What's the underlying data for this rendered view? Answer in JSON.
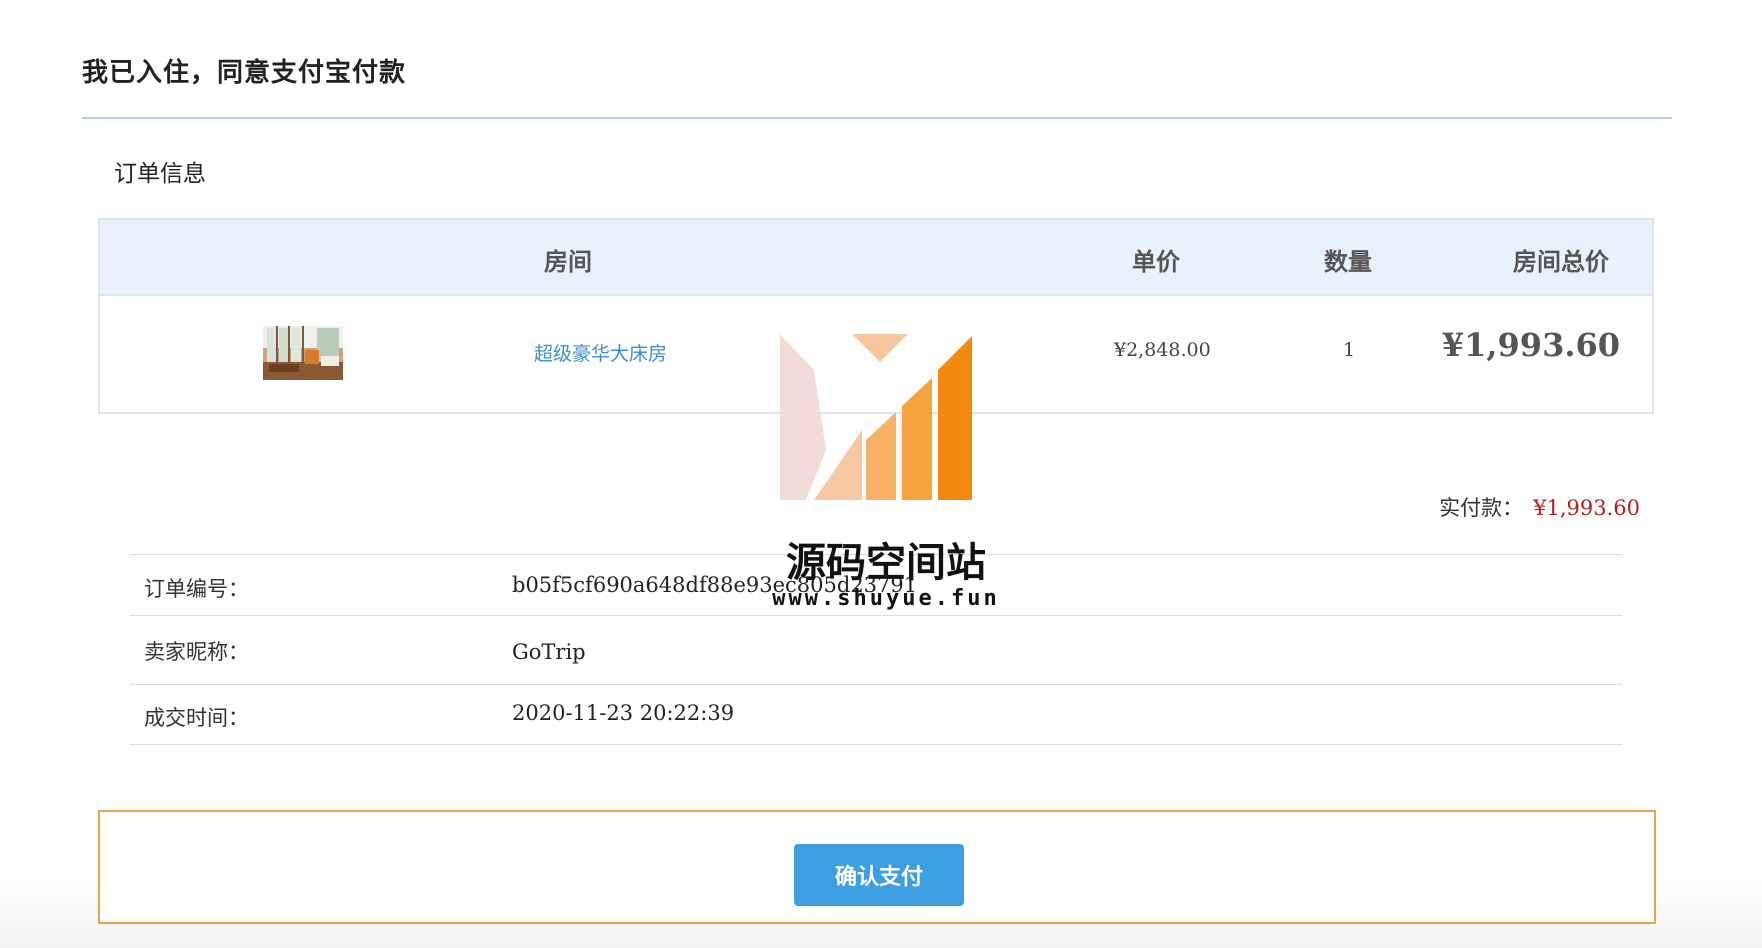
{
  "page": {
    "title": "我已入住，同意支付宝付款"
  },
  "order": {
    "section_title": "订单信息",
    "table": {
      "headers": {
        "room": "房间",
        "unit_price": "单价",
        "quantity": "数量",
        "room_total": "房间总价"
      },
      "rows": [
        {
          "room_name": "超级豪华大床房",
          "unit_price": "¥2,848.00",
          "quantity": "1",
          "room_total": "¥1,993.60"
        }
      ]
    },
    "paid": {
      "label": "实付款：",
      "value": "¥1,993.60"
    },
    "details": [
      {
        "label": "订单编号：",
        "value": "b05f5cf690a648df88e93ec805d23791"
      },
      {
        "label": "卖家昵称：",
        "value": "GoTrip"
      },
      {
        "label": "成交时间：",
        "value": "2020-11-23 20:22:39"
      }
    ]
  },
  "actions": {
    "confirm_pay": "确认支付"
  },
  "watermark": {
    "title": "源码空间站",
    "url": "www.shuyue.fun"
  },
  "colors": {
    "accent_blue": "#3d9ee2",
    "link_blue": "#3b8fc9",
    "price_red": "#b0201c",
    "header_bg": "#e8f2fd",
    "pay_box_border": "#e9a24b",
    "watermark_orange": "#f5880f"
  }
}
